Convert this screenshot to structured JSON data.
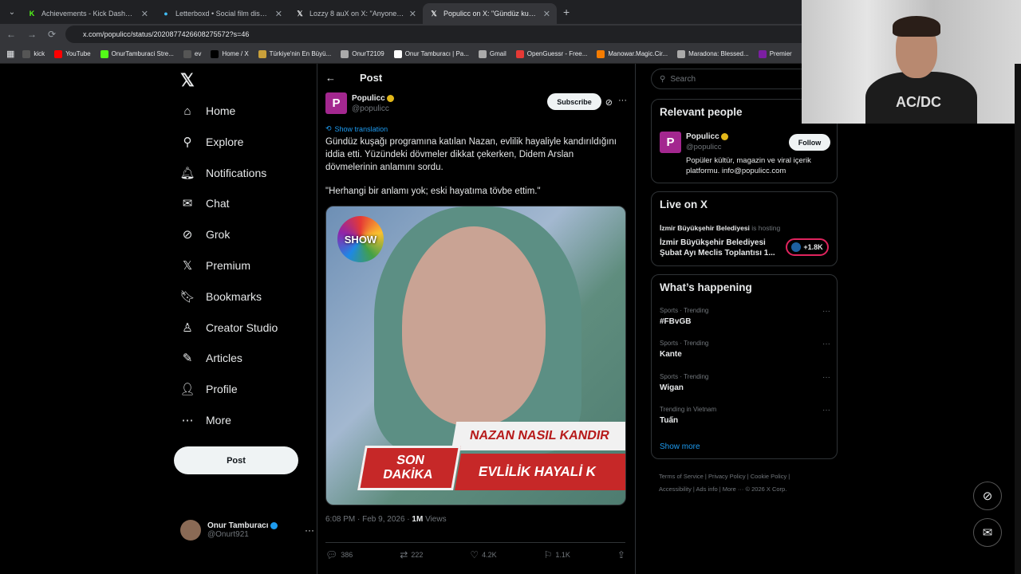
{
  "browser": {
    "tabs": [
      {
        "title": "Achievements - Kick Dashboard",
        "icon": "kick-icon",
        "active": false
      },
      {
        "title": "Letterboxd • Social film discov",
        "icon": "letterboxd-icon",
        "active": false
      },
      {
        "title": "Lozzy 8 auX on X: \"Anyone wa",
        "icon": "x-icon",
        "active": false
      },
      {
        "title": "Populicc on X: \"Gündüz kuşağı",
        "icon": "x-icon",
        "active": true
      }
    ],
    "url": "x.com/populicc/status/2020877426608275572?s=46",
    "bookmarks": [
      {
        "label": "kick",
        "color": "#555"
      },
      {
        "label": "YouTube",
        "color": "#ff0000"
      },
      {
        "label": "OnurTamburaci Stre...",
        "color": "#53fc18"
      },
      {
        "label": "ev",
        "color": "#555"
      },
      {
        "label": "Home / X",
        "color": "#000"
      },
      {
        "label": "Türkiye'nin En Büyü...",
        "color": "#c9a03a"
      },
      {
        "label": "OnurT2109",
        "color": "#aaa"
      },
      {
        "label": "Onur Tamburacı | Pa...",
        "color": "#fff"
      },
      {
        "label": "Gmail",
        "color": "#aaa"
      },
      {
        "label": "OpenGuessr - Free...",
        "color": "#e53935"
      },
      {
        "label": "Manowar.Magic.Cir...",
        "color": "#f57c00"
      },
      {
        "label": "Maradona: Blessed...",
        "color": "#aaa"
      },
      {
        "label": "Premier",
        "color": "#7b1fa2"
      }
    ]
  },
  "nav": {
    "items": [
      {
        "label": "Home",
        "icon": "home-icon",
        "glyph": "⌂"
      },
      {
        "label": "Explore",
        "icon": "search-icon",
        "glyph": "⚲"
      },
      {
        "label": "Notifications",
        "icon": "bell-icon",
        "glyph": "🔔︎"
      },
      {
        "label": "Chat",
        "icon": "mail-icon",
        "glyph": "✉"
      },
      {
        "label": "Grok",
        "icon": "grok-icon",
        "glyph": "⊘"
      },
      {
        "label": "Premium",
        "icon": "x-logo-icon",
        "glyph": "𝕏"
      },
      {
        "label": "Bookmarks",
        "icon": "bookmark-icon",
        "glyph": "🔖︎"
      },
      {
        "label": "Creator Studio",
        "icon": "creator-icon",
        "glyph": "♙"
      },
      {
        "label": "Articles",
        "icon": "article-icon",
        "glyph": "✎"
      },
      {
        "label": "Profile",
        "icon": "person-icon",
        "glyph": "👤︎"
      },
      {
        "label": "More",
        "icon": "more-icon",
        "glyph": "⋯"
      }
    ],
    "post_label": "Post",
    "account": {
      "name": "Onur Tamburacı",
      "handle": "@Onurt921"
    }
  },
  "post": {
    "header": "Post",
    "author": {
      "name": "Populicc",
      "handle": "@populicc",
      "avatar_letter": "P"
    },
    "subscribe_label": "Subscribe",
    "show_translation": "Show translation",
    "text": "Gündüz kuşağı programına katılan Nazan, evlilik hayaliyle kandırıldığını iddia etti. Yüzündeki dövmeler dikkat çekerken, Didem Arslan dövmelerinin anlamını sordu.",
    "quote": "\"Herhangi bir anlamı yok; eski hayatıma tövbe ettim.\"",
    "media": {
      "logo": "SHOW",
      "banner_top": "NAZAN NASIL KANDIR",
      "banner_bottom": "EVLİLİK HAYALİ K",
      "son": "SON",
      "dakika": "DAKİKA"
    },
    "time": "6:08 PM · Feb 9, 2026 · ",
    "views_count": "1M",
    "views_label": " Views",
    "stats": {
      "replies": "386",
      "reposts": "222",
      "likes": "4.2K",
      "bookmarks": "1.1K"
    }
  },
  "right": {
    "search_placeholder": "Search",
    "relevant": {
      "title": "Relevant people",
      "name": "Populicc",
      "handle": "@populicc",
      "follow_label": "Follow",
      "bio": "Popüler kültür, magazin ve viral içerik platformu. info@populicc.com"
    },
    "live": {
      "title": "Live on X",
      "host": "İzmir Büyükşehir Belediyesi",
      "hosting": " is hosting",
      "event": "İzmir Büyükşehir Belediyesi Şubat Ayı Meclis Toplantısı 1...",
      "count": "+1.8K"
    },
    "happening": {
      "title": "What’s happening",
      "trends": [
        {
          "category": "Sports · Trending",
          "name": "#FBvGB"
        },
        {
          "category": "Sports · Trending",
          "name": "Kante"
        },
        {
          "category": "Sports · Trending",
          "name": "Wigan"
        },
        {
          "category": "Trending in Vietnam",
          "name": "Tuấn"
        }
      ],
      "show_more": "Show more"
    },
    "footer": {
      "line1": "Terms of Service  |  Privacy Policy  |  Cookie Policy  |",
      "line2": "Accessibility  |  Ads info  |  More ···  © 2026 X Corp."
    }
  },
  "webcam": {
    "shirt_text": "AC/DC"
  }
}
